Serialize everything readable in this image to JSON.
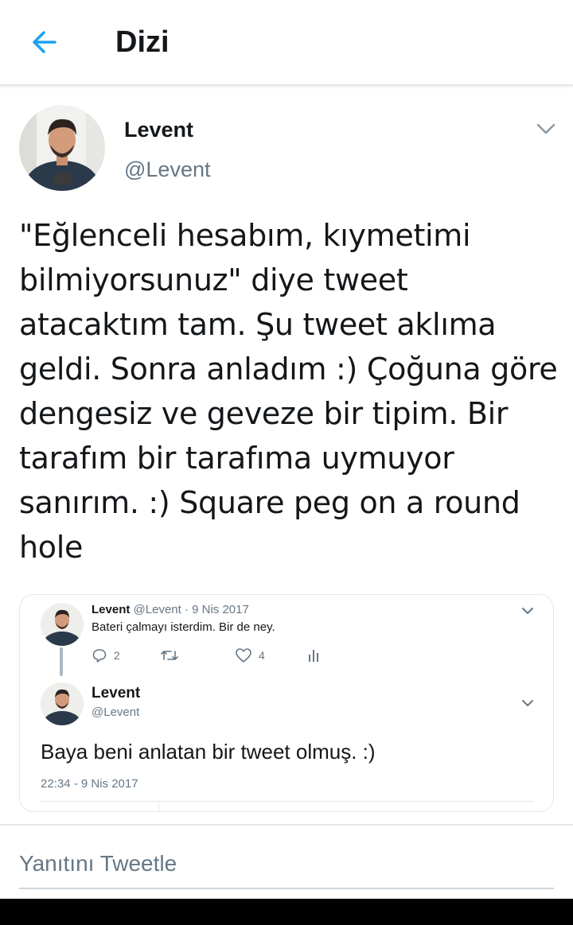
{
  "header": {
    "title": "Dizi",
    "back_icon": "arrow-left-icon"
  },
  "tweet": {
    "author_name": "Levent",
    "author_handle": "@Levent",
    "text": "\"Eğlenceli hesabım, kıymetimi bilmiyorsunuz\" diye tweet atacaktım tam. Şu tweet aklıma geldi. Sonra anladım :) Çoğuna göre dengesiz ve geveze bir tipim. Bir tarafım bir tarafıma uymuyor sanırım. :) Square peg on a round hole"
  },
  "quoted": {
    "parent": {
      "name": "Levent",
      "handle_date": "@Levent · 9 Nis 2017",
      "text": "Bateri çalmayı isterdim. Bir de ney.",
      "replies": "2",
      "likes": "4"
    },
    "reply": {
      "name": "Levent",
      "handle": "@Levent",
      "text": "Baya beni anlatan bir tweet olmuş. :)",
      "timestamp": "22:34 - 9 Nis 2017"
    }
  },
  "reply_box": {
    "placeholder": "Yanıtını Tweetle"
  },
  "colors": {
    "accent": "#1da1f2",
    "text": "#14171a",
    "muted": "#657786",
    "border": "#e1e8ed"
  }
}
